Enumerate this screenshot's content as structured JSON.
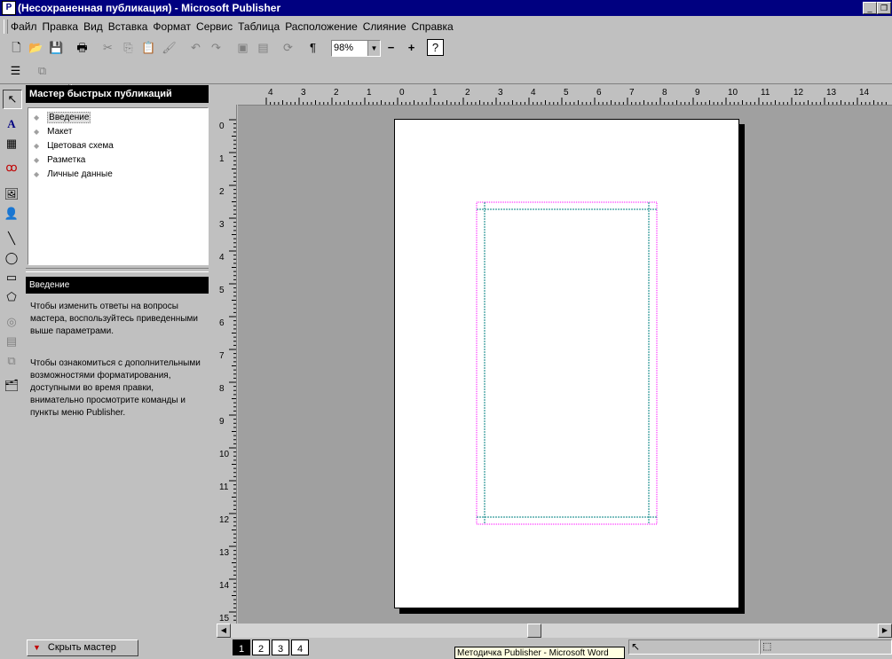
{
  "window": {
    "title": "(Несохраненная публикация) - Microsoft Publisher"
  },
  "menu": [
    "Файл",
    "Правка",
    "Вид",
    "Вставка",
    "Формат",
    "Сервис",
    "Таблица",
    "Расположение",
    "Слияние",
    "Справка"
  ],
  "toolbar": {
    "zoom": "98%"
  },
  "wizard": {
    "title": "Мастер быстрых публикаций",
    "items": [
      "Введение",
      "Макет",
      "Цветовая схема",
      "Разметка",
      "Личные данные"
    ],
    "selected_index": 0,
    "section_title": "Введение",
    "paragraph1": "Чтобы изменить ответы на вопросы мастера,  воспользуйтесь приведенными выше параметрами.",
    "paragraph2": "Чтобы ознакомиться с дополнительными возможностями форматирования, доступными во время правки, внимательно просмотрите команды и пункты меню Publisher.",
    "hide_button": "Скрыть мастер"
  },
  "rulers": {
    "horizontal_labels": [
      "4",
      "3",
      "2",
      "1",
      "0",
      "1",
      "2",
      "3",
      "4",
      "5",
      "6",
      "7",
      "8",
      "9",
      "10",
      "11",
      "12",
      "13",
      "14"
    ],
    "vertical_labels": [
      "0",
      "1",
      "2",
      "3",
      "4",
      "5",
      "6",
      "7",
      "8",
      "9",
      "10",
      "11",
      "12",
      "13",
      "14",
      "15"
    ]
  },
  "pages": [
    "1",
    "2",
    "3",
    "4"
  ],
  "current_page": "1",
  "tooltip": "Методичка  Publisher - Microsoft Word",
  "colors": {
    "titlebar": "#000080",
    "face": "#c0c0c0",
    "workspace": "#a0a0a0",
    "margin_guide": "#ff00ff",
    "layout_guide": "#008080"
  }
}
